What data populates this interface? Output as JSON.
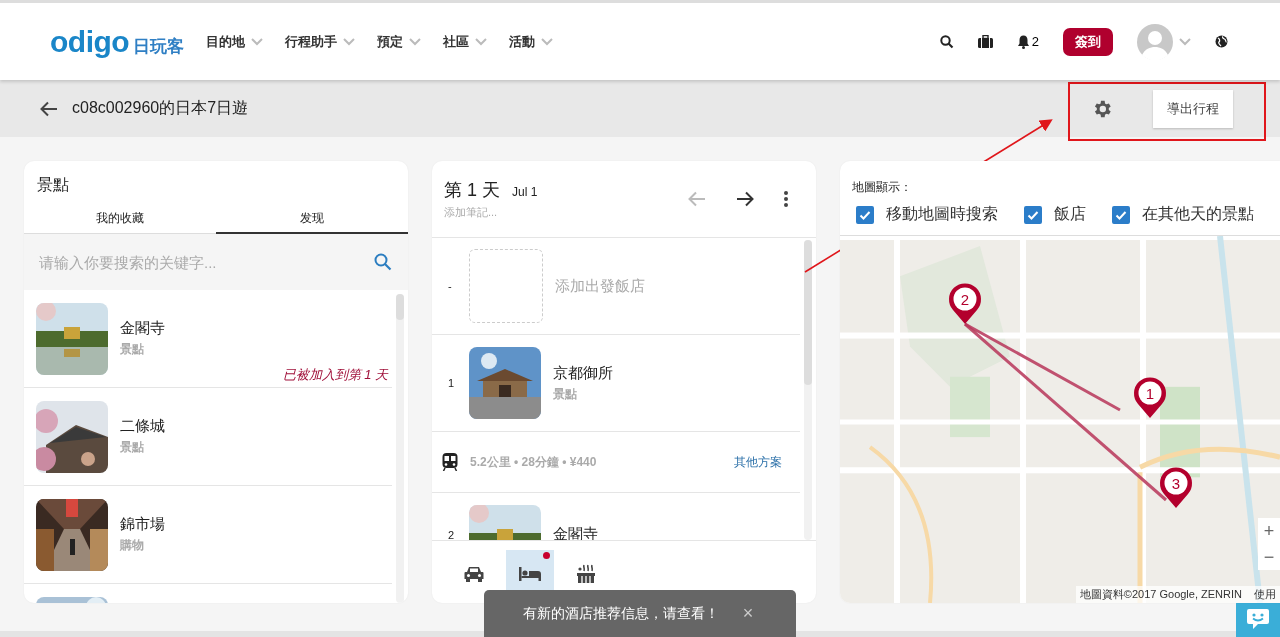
{
  "header": {
    "logo": {
      "wordmark": "odigo",
      "name": "日玩客"
    },
    "nav": [
      {
        "label": "目的地"
      },
      {
        "label": "行程助手"
      },
      {
        "label": "預定"
      },
      {
        "label": "社區"
      },
      {
        "label": "活動"
      }
    ],
    "notifications": "2",
    "signin": "簽到"
  },
  "trip_bar": {
    "title": "c08c002960的日本7日遊",
    "export_button": "導出行程"
  },
  "attractions": {
    "title": "景點",
    "tabs": [
      {
        "label": "我的收藏",
        "selected": false
      },
      {
        "label": "发现",
        "selected": true
      }
    ],
    "search": {
      "placeholder": "请输入你要搜索的关键字..."
    },
    "items": [
      {
        "name": "金閣寺",
        "category": "景點",
        "note": "已被加入到第 1 天"
      },
      {
        "name": "二條城",
        "category": "景點"
      },
      {
        "name": "錦市場",
        "category": "購物"
      }
    ]
  },
  "day": {
    "title": "第 1 天",
    "date": "Jul 1",
    "note_placeholder": "添加筆記...",
    "hotel": {
      "marker": "-",
      "label": "添加出發飯店"
    },
    "stops": [
      {
        "index": "1",
        "name": "京都御所",
        "category": "景點"
      }
    ],
    "transit": {
      "summary": "5.2公里 • 28分鐘 • ¥440",
      "link": "其他方案"
    },
    "next_stop": {
      "index": "2",
      "name": "金閣寺"
    },
    "bottom_tabs": [
      {
        "kind": "car",
        "selected": false,
        "badge": false
      },
      {
        "kind": "bed",
        "selected": true,
        "badge": true
      },
      {
        "kind": "onsen",
        "selected": false,
        "badge": false
      }
    ]
  },
  "toast": {
    "text": "有新的酒店推荐信息，请查看！",
    "close": "×"
  },
  "map": {
    "label": "地圖顯示：",
    "options": [
      {
        "label": "移動地圖時搜索",
        "checked": true
      },
      {
        "label": "飯店",
        "checked": true
      },
      {
        "label": "在其他天的景點",
        "checked": true
      }
    ],
    "pins": [
      {
        "label": "2"
      },
      {
        "label": "1"
      },
      {
        "label": "3"
      }
    ],
    "attribution": "地圖資料©2017 Google, ZENRIN",
    "terms": "使用",
    "zoom_in": "+",
    "zoom_out": "−"
  }
}
